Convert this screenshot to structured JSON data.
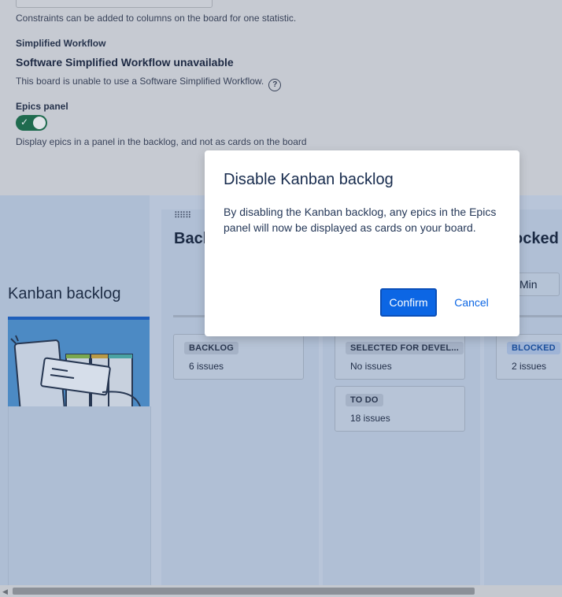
{
  "settings": {
    "constraints_help": "Constraints can be added to columns on the board for one statistic.",
    "simplified_workflow": {
      "label": "Simplified Workflow",
      "title": "Software Simplified Workflow unavailable",
      "help": "This board is unable to use a Software Simplified Workflow."
    },
    "epics_panel": {
      "label": "Epics panel",
      "toggle_on": true,
      "help": "Display epics in a panel in the backlog, and not as cards on the board"
    }
  },
  "board": {
    "kanban_backlog_title": "Kanban backlog",
    "columns": [
      {
        "heading": "Back"
      },
      {
        "heading": ""
      },
      {
        "heading": "ocked"
      }
    ],
    "min_label": "Min",
    "cards": [
      {
        "status": "BACKLOG",
        "count": "6 issues"
      },
      {
        "status": "SELECTED FOR DEVEL...",
        "count": "No issues"
      },
      {
        "status": "TO DO",
        "count": "18 issues"
      },
      {
        "status": "BLOCKED",
        "count": "2 issues"
      }
    ]
  },
  "modal": {
    "title": "Disable Kanban backlog",
    "body": "By disabling the Kanban backlog, any epics in the Epics panel will now be displayed as cards on your board.",
    "confirm_label": "Confirm",
    "cancel_label": "Cancel"
  },
  "colors": {
    "primary": "#0c66e4",
    "toggle_on": "#1f6b4f",
    "blocked_status": "#1b4f9c"
  },
  "icons": [
    "help-icon",
    "check-icon",
    "drag-handle-icon",
    "scroll-left-icon"
  ]
}
